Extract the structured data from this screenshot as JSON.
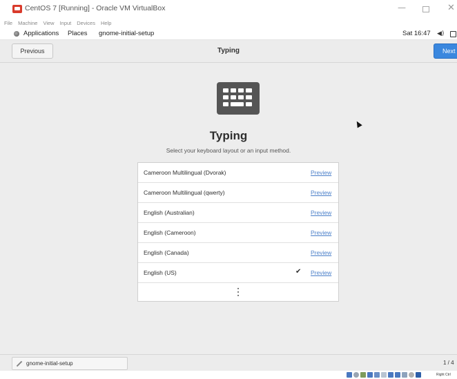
{
  "window": {
    "title": "CentOS 7 [Running] - Oracle VM VirtualBox",
    "controls": [
      "minimize-icon",
      "maximize-icon",
      "close-icon"
    ]
  },
  "vbox_menu": {
    "items": [
      "File",
      "Machine",
      "View",
      "Input",
      "Devices",
      "Help"
    ]
  },
  "gnome_topbar": {
    "applications": "Applications",
    "places": "Places",
    "app_name": "gnome-initial-setup",
    "clock": "Sat 16:47",
    "volume_icon": "speaker-icon",
    "system_icon": "system-menu-icon"
  },
  "setup_header": {
    "previous_label": "Previous",
    "title": "Typing",
    "next_label": "Next",
    "next_color": "#3a87de"
  },
  "main": {
    "icon": "keyboard-icon",
    "title": "Typing",
    "subtitle": "Select your keyboard layout or an input method.",
    "layouts": [
      {
        "name": "Cameroon Multilingual (Dvorak)",
        "preview": "Preview",
        "selected": false
      },
      {
        "name": "Cameroon Multilingual (qwerty)",
        "preview": "Preview",
        "selected": false
      },
      {
        "name": "English (Australian)",
        "preview": "Preview",
        "selected": false
      },
      {
        "name": "English (Cameroon)",
        "preview": "Preview",
        "selected": false
      },
      {
        "name": "English (Canada)",
        "preview": "Preview",
        "selected": false
      },
      {
        "name": "English (US)",
        "preview": "Preview",
        "selected": true,
        "check": "✔"
      }
    ],
    "more_icon": "more-vertical-icon",
    "link_color": "#4a7fc9"
  },
  "taskbar": {
    "item_label": "gnome-initial-setup",
    "workspace": "1 / 4"
  },
  "vbox_status": {
    "host_key": "Right Ctrl"
  }
}
